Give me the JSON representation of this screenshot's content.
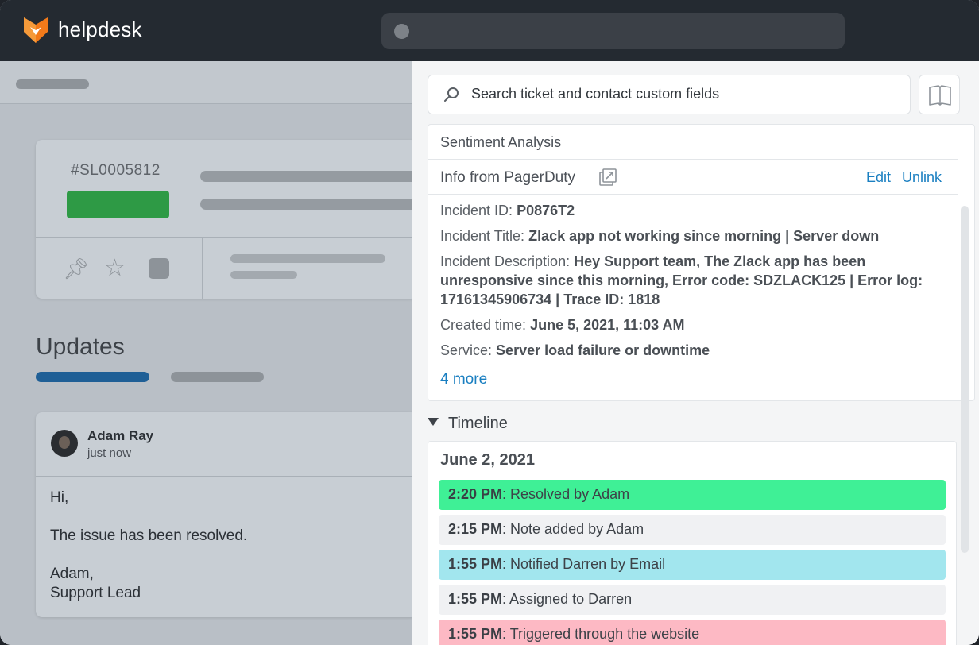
{
  "app": {
    "brand": "helpdesk"
  },
  "ticket": {
    "id": "#SL0005812"
  },
  "updates": {
    "title": "Updates",
    "author": "Adam Ray",
    "time": "just now",
    "message": "Hi,\n\nThe issue has been resolved.\n\nAdam,\nSupport Lead"
  },
  "panel": {
    "search_placeholder": "Search ticket and contact custom fields",
    "sentiment_title": "Sentiment Analysis",
    "pagerduty": {
      "title": "Info from PagerDuty",
      "edit_label": "Edit",
      "unlink_label": "Unlink",
      "fields": [
        {
          "label": "Incident ID:",
          "value": "P0876T2"
        },
        {
          "label": "Incident Title:",
          "value": "Zlack app not working since morning | Server down"
        },
        {
          "label": "Incident Description:",
          "value": "Hey Support team, The Zlack app has been unresponsive since this morning, Error code: SDZLACK125 | Error log: 17161345906734 | Trace ID: 1818"
        },
        {
          "label": "Created time:",
          "value": "June 5, 2021, 11:03 AM"
        },
        {
          "label": "Service:",
          "value": "Server load failure or downtime"
        }
      ],
      "more_label": "4 more"
    },
    "timeline": {
      "title": "Timeline",
      "date": "June 2, 2021",
      "events": [
        {
          "time": "2:20 PM",
          "text": ": Resolved by Adam",
          "color": "#3ff096"
        },
        {
          "time": "2:15 PM",
          "text": ": Note added by Adam",
          "color": "#f0f1f3"
        },
        {
          "time": "1:55 PM",
          "text": ": Notified Darren by Email",
          "color": "#a2e6ee"
        },
        {
          "time": "1:55 PM",
          "text": ": Assigned to Darren",
          "color": "#f0f1f3"
        },
        {
          "time": "1:55 PM",
          "text": ": Triggered through the website",
          "color": "#fdb9c4"
        }
      ]
    }
  },
  "colors": {
    "topbar": "#242a31",
    "link": "#1a7fc1",
    "status_green": "#2e9a45"
  }
}
